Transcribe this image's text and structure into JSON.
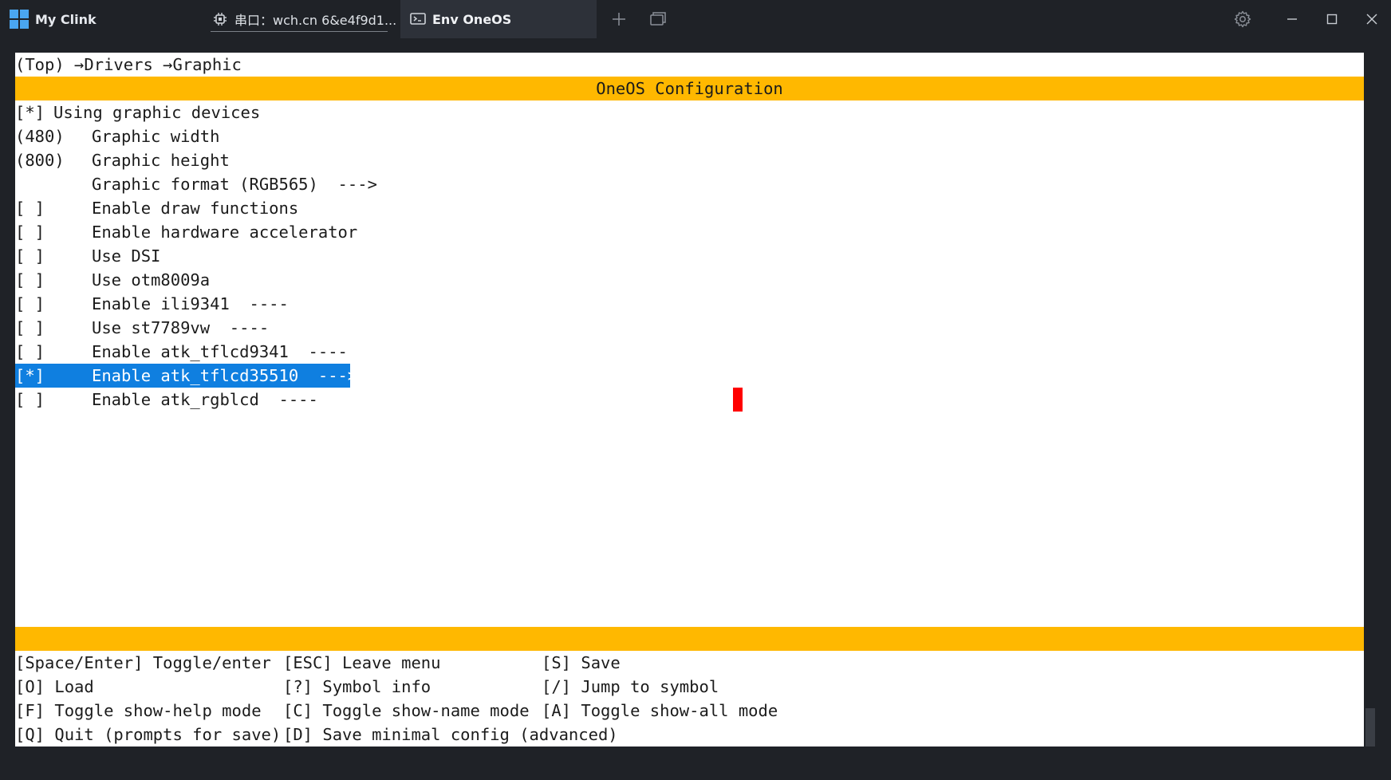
{
  "window": {
    "app_title": "My Clink",
    "tabs": [
      {
        "label": "串口：wch.cn 6&e4f9d1...",
        "icon": "chip-icon",
        "active": false
      },
      {
        "label": "Env OneOS",
        "icon": "terminal-icon",
        "active": true
      }
    ],
    "accent_color": "#4aa6f0"
  },
  "terminal": {
    "breadcrumb": "(Top) →Drivers →Graphic",
    "banner_title": "OneOS Configuration",
    "banner_color": "#ffb800",
    "selected_color": "#0f7fe0",
    "menu_items": [
      {
        "mark": "[*]",
        "label": "Using graphic devices",
        "selected": false
      },
      {
        "mark": "(480)",
        "label": "Graphic width",
        "selected": false
      },
      {
        "mark": "(800)",
        "label": "Graphic height",
        "selected": false
      },
      {
        "mark": "",
        "label": "Graphic format (RGB565)  --->",
        "selected": false
      },
      {
        "mark": "[ ]",
        "label": "Enable draw functions",
        "selected": false
      },
      {
        "mark": "[ ]",
        "label": "Enable hardware accelerator",
        "selected": false
      },
      {
        "mark": "[ ]",
        "label": "Use DSI",
        "selected": false
      },
      {
        "mark": "[ ]",
        "label": "Use otm8009a",
        "selected": false
      },
      {
        "mark": "[ ]",
        "label": "Enable ili9341  ----",
        "selected": false
      },
      {
        "mark": "[ ]",
        "label": "Use st7789vw  ----",
        "selected": false
      },
      {
        "mark": "[ ]",
        "label": "Enable atk_tflcd9341  ----",
        "selected": false
      },
      {
        "mark": "[*]",
        "label": "Enable atk_tflcd35510  --->",
        "selected": true
      },
      {
        "mark": "[ ]",
        "label": "Enable atk_rgblcd  ----",
        "selected": false
      }
    ],
    "help": [
      [
        "[Space/Enter] Toggle/enter",
        "[ESC] Leave menu",
        "[S] Save"
      ],
      [
        "[O] Load",
        "[?] Symbol info",
        "[/] Jump to symbol"
      ],
      [
        "[F] Toggle show-help mode",
        "[C] Toggle show-name mode",
        "[A] Toggle show-all mode"
      ],
      [
        "[Q] Quit (prompts for save)",
        "[D] Save minimal config (advanced)",
        ""
      ]
    ]
  }
}
